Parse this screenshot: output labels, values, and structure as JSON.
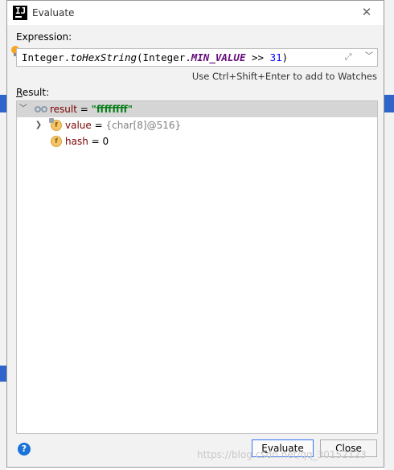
{
  "dialog": {
    "title": "Evaluate",
    "expression_label": "Expression:",
    "expression": {
      "p1": "Integer.",
      "p2": "toHexString",
      "p3": "(Integer.",
      "p4": "MIN_VALUE",
      "p5": " >> ",
      "p6": "31",
      "p7": ")"
    },
    "hint": "Use Ctrl+Shift+Enter to add to Watches",
    "result_label": "Result:",
    "result_label_mnemonic": "R",
    "result_label_rest": "esult:",
    "tree": [
      {
        "name": "result",
        "eq": " = ",
        "value": "\"ffffffff\"",
        "expanded": true,
        "selected": true
      },
      {
        "name": "value",
        "eq": " = ",
        "value": "{char[8]@516}",
        "expanded": false,
        "icon": "field-icon",
        "badge": "f"
      },
      {
        "name": "hash",
        "eq": " = ",
        "value": "0",
        "icon": "field-icon",
        "badge": "f"
      }
    ],
    "buttons": {
      "evaluate": "Evaluate",
      "close": "Close",
      "help": "?"
    },
    "evaluate_mnemonic": "E",
    "evaluate_rest": "valuate"
  },
  "watermark": "https://blog.csdn.net/qq_30152123",
  "colors": {
    "accent": "#3574f0",
    "string_value": "#067d17",
    "field_name": "#7a0000",
    "constant": "#660e7a",
    "number": "#0000ff"
  },
  "icons": [
    "app-logo-icon",
    "close-icon",
    "bulb-icon",
    "expand-icon",
    "dropdown-icon",
    "watch-icon",
    "field-icon",
    "help-icon",
    "chevron-down-icon",
    "chevron-right-icon"
  ]
}
